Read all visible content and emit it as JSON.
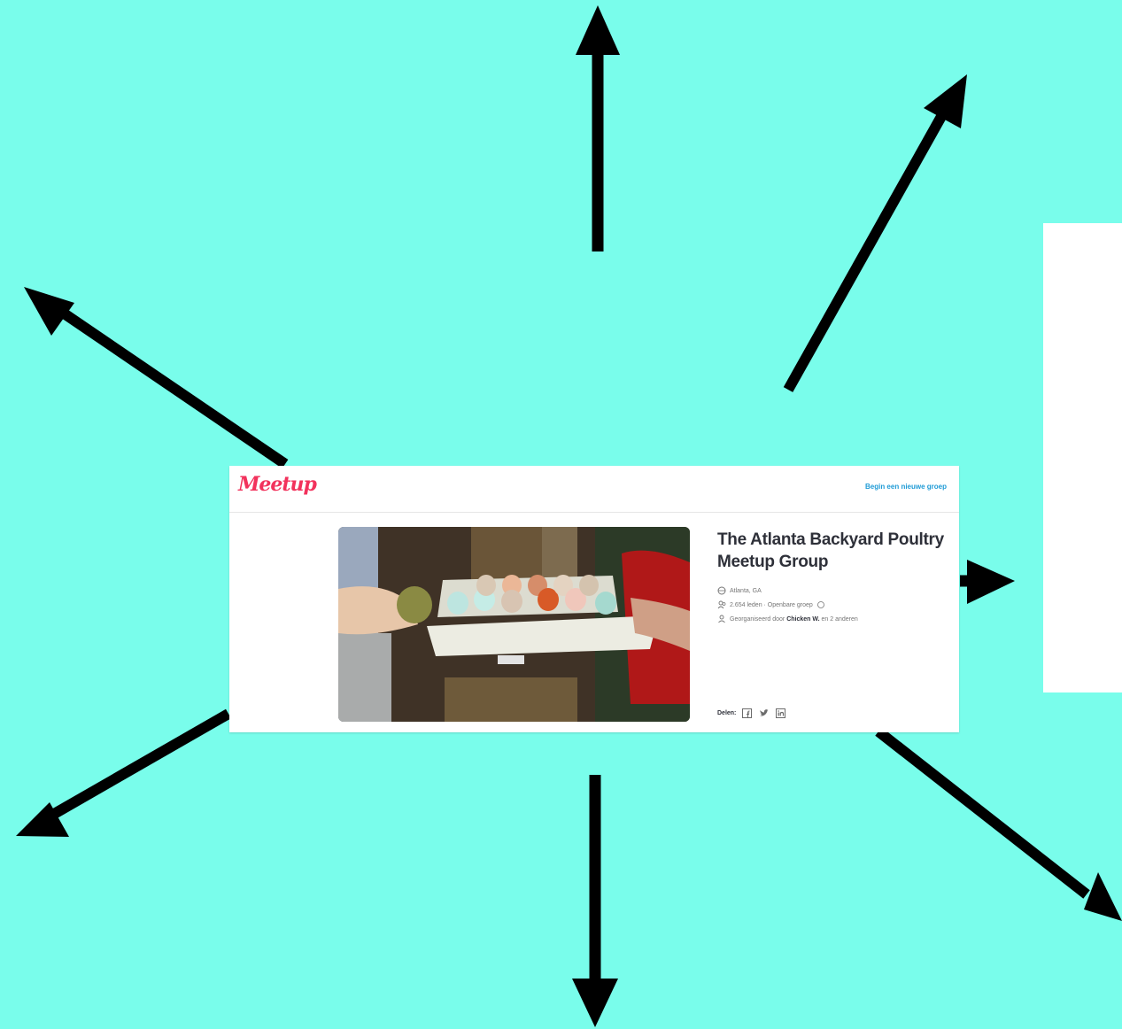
{
  "background_color": "#79fdeb",
  "accent_color": "#f2325c",
  "link_color": "#1f9bd6",
  "card": {
    "logo_text": "Meetup",
    "start_group_link": "Begin een nieuwe groep",
    "group_title": "The Atlanta Backyard Poultry Meetup Group",
    "location": "Atlanta, GA",
    "members_and_type": "2.654 leden · Openbare groep",
    "organized_prefix": "Georganiseerd door",
    "organizer_name": "Chicken W.",
    "organized_suffix": "en 2 anderen",
    "share_label": "Delen:",
    "share_icons": [
      "facebook-icon",
      "twitter-icon",
      "linkedin-icon"
    ],
    "photo_subject": "hands-holding-egg-carton"
  },
  "arrow_count": 8
}
